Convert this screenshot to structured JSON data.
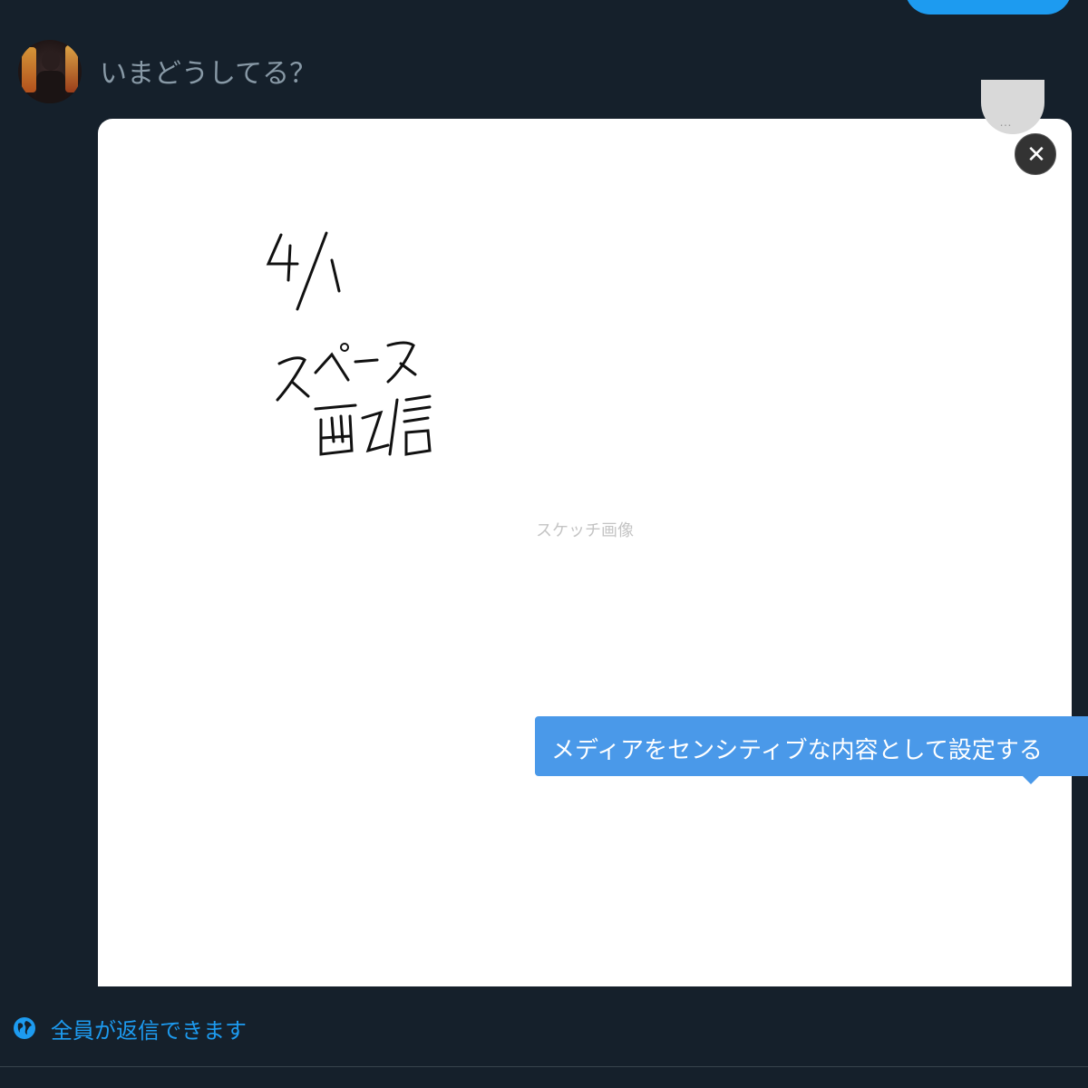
{
  "composer": {
    "placeholder": "いまどうしてる？"
  },
  "media": {
    "alt": "スケッチ画像",
    "handwriting": [
      "4/1",
      "スペース配信"
    ]
  },
  "media_controls": {
    "more_label": "…",
    "close_label": "✕"
  },
  "tooltip": {
    "text": "メディアをセンシティブな内容として設定する"
  },
  "reply": {
    "label": "全員が返信できます",
    "icon": "globe-icon"
  },
  "colors": {
    "background": "#15202b",
    "accent": "#1d9bf0",
    "tooltip": "#4a99e9"
  }
}
